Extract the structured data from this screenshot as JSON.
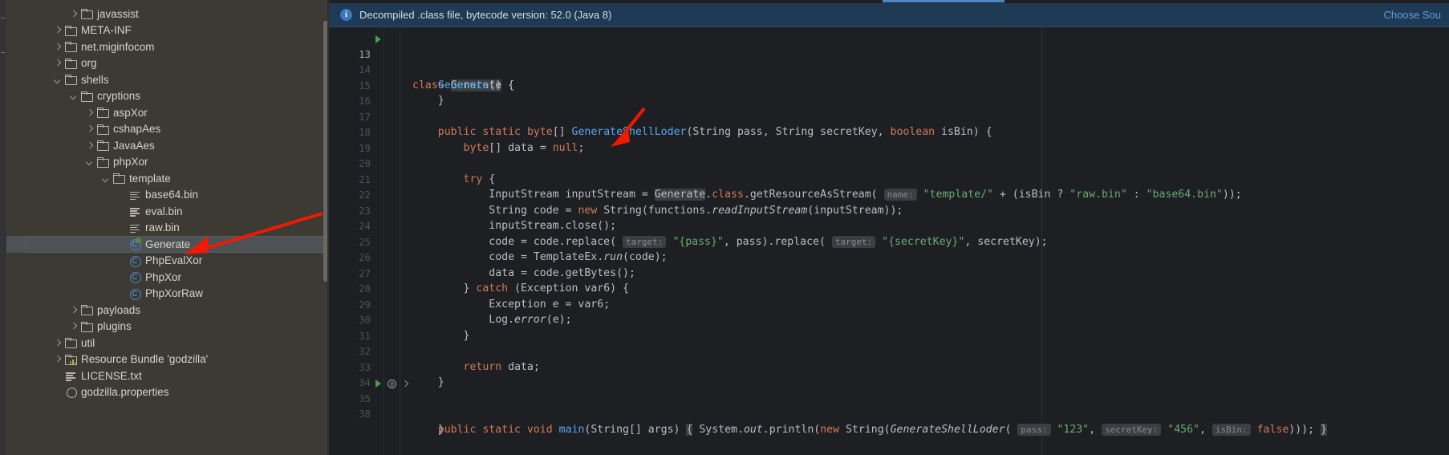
{
  "tree": {
    "name": "project-tree",
    "items": [
      {
        "label": "javassist",
        "indent": 3,
        "toggle": "right",
        "icon": "folder-icon"
      },
      {
        "label": "META-INF",
        "indent": 2,
        "toggle": "right",
        "icon": "folder-icon"
      },
      {
        "label": "net.miginfocom",
        "indent": 2,
        "toggle": "right",
        "icon": "folder-icon"
      },
      {
        "label": "org",
        "indent": 2,
        "toggle": "right",
        "icon": "folder-icon"
      },
      {
        "label": "shells",
        "indent": 2,
        "toggle": "down",
        "icon": "folder-icon"
      },
      {
        "label": "cryptions",
        "indent": 3,
        "toggle": "down",
        "icon": "folder-icon"
      },
      {
        "label": "aspXor",
        "indent": 4,
        "toggle": "right",
        "icon": "folder-icon"
      },
      {
        "label": "cshapAes",
        "indent": 4,
        "toggle": "right",
        "icon": "folder-icon"
      },
      {
        "label": "JavaAes",
        "indent": 4,
        "toggle": "right",
        "icon": "folder-icon"
      },
      {
        "label": "phpXor",
        "indent": 4,
        "toggle": "down",
        "icon": "folder-icon"
      },
      {
        "label": "template",
        "indent": 5,
        "toggle": "down",
        "icon": "folder-icon"
      },
      {
        "label": "base64.bin",
        "indent": 6,
        "toggle": "none",
        "icon": "file-icon"
      },
      {
        "label": "eval.bin",
        "indent": 6,
        "toggle": "none",
        "icon": "file-icon"
      },
      {
        "label": "raw.bin",
        "indent": 6,
        "toggle": "none",
        "icon": "file-icon"
      },
      {
        "label": "Generate",
        "indent": 6,
        "toggle": "none",
        "icon": "java-class-runnable-icon",
        "selected": true
      },
      {
        "label": "PhpEvalXor",
        "indent": 6,
        "toggle": "none",
        "icon": "java-class-icon"
      },
      {
        "label": "PhpXor",
        "indent": 6,
        "toggle": "none",
        "icon": "java-class-icon"
      },
      {
        "label": "PhpXorRaw",
        "indent": 6,
        "toggle": "none",
        "icon": "java-class-icon"
      },
      {
        "label": "payloads",
        "indent": 3,
        "toggle": "right",
        "icon": "folder-icon"
      },
      {
        "label": "plugins",
        "indent": 3,
        "toggle": "right",
        "icon": "folder-icon"
      },
      {
        "label": "util",
        "indent": 2,
        "toggle": "right",
        "icon": "folder-icon"
      },
      {
        "label": "Resource Bundle 'godzilla'",
        "indent": 2,
        "toggle": "right",
        "icon": "resource-bundle-icon"
      },
      {
        "label": "LICENSE.txt",
        "indent": 2,
        "toggle": "none",
        "icon": "file-icon"
      },
      {
        "label": "godzilla.properties",
        "indent": 2,
        "toggle": "none",
        "icon": "properties-icon",
        "clipped": true
      }
    ]
  },
  "editor": {
    "notification": "Decompiled .class file, bytecode version: 52.0 (Java 8)",
    "choose_sources": "Choose Sou",
    "lines": [
      {
        "num": "13",
        "marker": "run"
      },
      {
        "num": "14"
      },
      {
        "num": "15"
      },
      {
        "num": "16"
      },
      {
        "num": "17"
      },
      {
        "num": "18"
      },
      {
        "num": "19"
      },
      {
        "num": "20"
      },
      {
        "num": "21"
      },
      {
        "num": "22"
      },
      {
        "num": "23"
      },
      {
        "num": "24"
      },
      {
        "num": "25"
      },
      {
        "num": "26"
      },
      {
        "num": "27"
      },
      {
        "num": "28"
      },
      {
        "num": "29"
      },
      {
        "num": "30"
      },
      {
        "num": "31"
      },
      {
        "num": "32"
      },
      {
        "num": "33"
      },
      {
        "num": "34"
      },
      {
        "num": "35",
        "marker": "run-at"
      },
      {
        "num": "38"
      }
    ],
    "code": {
      "l13": "class Generate {",
      "l14": "Generate() {",
      "l15": "}",
      "l17": "public static byte[] GenerateShellLoder(String pass, String secretKey, boolean isBin) {",
      "l18": "byte[] data = null;",
      "l20": "try {",
      "l21": "InputStream inputStream = Generate.class.getResourceAsStream( name: \"template/\" + (isBin ? \"raw.bin\" : \"base64.bin\"));",
      "l22": "String code = new String(functions.readInputStream(inputStream));",
      "l23": "inputStream.close();",
      "l24": "code = code.replace( target: \"{pass}\", pass).replace( target: \"{secretKey}\", secretKey);",
      "l25": "code = TemplateEx.run(code);",
      "l26": "data = code.getBytes();",
      "l27": "} catch (Exception var6) {",
      "l28": "Exception e = var6;",
      "l29": "Log.error(e);",
      "l30": "}",
      "l32": "return data;",
      "l33": "}",
      "l35": "public static void main(String[] args) { System.out.println(new String(GenerateShellLoder( pass: \"123\", secretKey: \"456\", isBin: false))); }",
      "l38": "}",
      "hints": {
        "name": "name:",
        "target": "target:",
        "pass": "pass:",
        "secretKey": "secretKey:",
        "isBin": "isBin:"
      },
      "strings": {
        "template": "\"template/\"",
        "raw": "\"raw.bin\"",
        "base64": "\"base64.bin\"",
        "pass_tok": "\"{pass}\"",
        "secret_tok": "\"{secretKey}\"",
        "v123": "\"123\"",
        "v456": "\"456\""
      }
    }
  },
  "colors": {
    "tree_bg": "#3c3a33",
    "editor_bg": "#1e1f22",
    "notif_bg": "#1f3a54",
    "accent": "#4a88c7",
    "string": "#6aab73",
    "keyword": "#cf8e6d",
    "method": "#56a8f5",
    "annotation_arrow": "#f01a00"
  }
}
